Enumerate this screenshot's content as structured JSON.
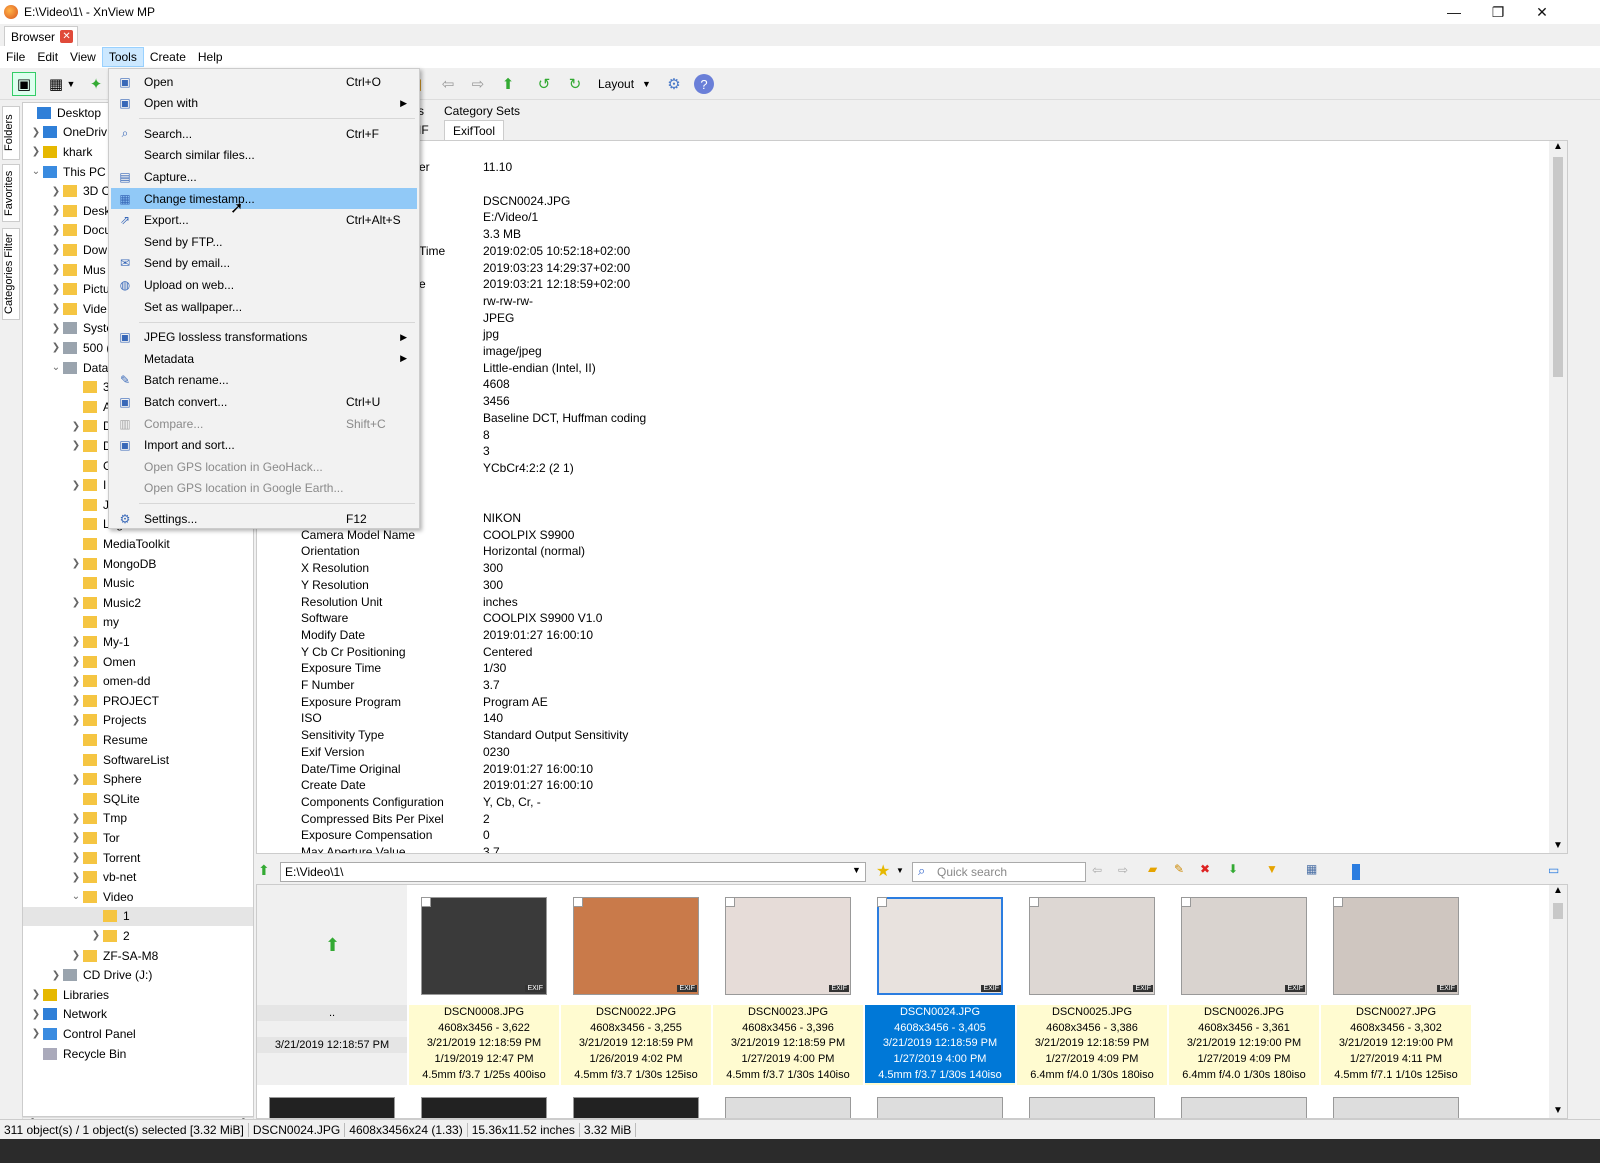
{
  "window": {
    "title": "E:\\Video\\1\\ - XnView MP",
    "min": "—",
    "max": "❐",
    "close": "✕"
  },
  "tab": {
    "label": "Browser",
    "close": "✕"
  },
  "menubar": [
    "File",
    "Edit",
    "View",
    "Tools",
    "Create",
    "Help"
  ],
  "toolbar": {
    "layout_label": "Layout"
  },
  "sidetabs": [
    "Folders",
    "Favorites",
    "Categories Filter"
  ],
  "tree": [
    {
      "label": "Desktop",
      "indent": 0,
      "arrow": "",
      "icon": "desktop"
    },
    {
      "label": "OneDriv",
      "indent": 1,
      "arrow": ">",
      "icon": "cloud"
    },
    {
      "label": "khark",
      "indent": 1,
      "arrow": ">",
      "icon": "user"
    },
    {
      "label": "This PC",
      "indent": 1,
      "arrow": "v",
      "icon": "pc"
    },
    {
      "label": "3D O",
      "indent": 2,
      "arrow": ">",
      "icon": "folder"
    },
    {
      "label": "Desk",
      "indent": 2,
      "arrow": ">",
      "icon": "folder"
    },
    {
      "label": "Docu",
      "indent": 2,
      "arrow": ">",
      "icon": "folder"
    },
    {
      "label": "Dow",
      "indent": 2,
      "arrow": ">",
      "icon": "folder"
    },
    {
      "label": "Mus",
      "indent": 2,
      "arrow": ">",
      "icon": "folder"
    },
    {
      "label": "Pictu",
      "indent": 2,
      "arrow": ">",
      "icon": "folder"
    },
    {
      "label": "Vide",
      "indent": 2,
      "arrow": ">",
      "icon": "folder"
    },
    {
      "label": "Syste",
      "indent": 2,
      "arrow": ">",
      "icon": "drive"
    },
    {
      "label": "500 (",
      "indent": 2,
      "arrow": ">",
      "icon": "drive"
    },
    {
      "label": "Data",
      "indent": 2,
      "arrow": "v",
      "icon": "drive"
    },
    {
      "label": "3",
      "indent": 3,
      "arrow": "",
      "icon": "folder"
    },
    {
      "label": "A",
      "indent": 3,
      "arrow": "",
      "icon": "folder"
    },
    {
      "label": "D",
      "indent": 3,
      "arrow": ">",
      "icon": "folder"
    },
    {
      "label": "D",
      "indent": 3,
      "arrow": ">",
      "icon": "folder"
    },
    {
      "label": "G",
      "indent": 3,
      "arrow": "",
      "icon": "folder"
    },
    {
      "label": "I",
      "indent": 3,
      "arrow": ">",
      "icon": "folder"
    },
    {
      "label": "J",
      "indent": 3,
      "arrow": "",
      "icon": "folder"
    },
    {
      "label": "LoginScreen",
      "indent": 3,
      "arrow": "",
      "icon": "folder"
    },
    {
      "label": "MediaToolkit",
      "indent": 3,
      "arrow": "",
      "icon": "folder"
    },
    {
      "label": "MongoDB",
      "indent": 3,
      "arrow": ">",
      "icon": "folder"
    },
    {
      "label": "Music",
      "indent": 3,
      "arrow": "",
      "icon": "folder"
    },
    {
      "label": "Music2",
      "indent": 3,
      "arrow": ">",
      "icon": "folder"
    },
    {
      "label": "my",
      "indent": 3,
      "arrow": "",
      "icon": "folder"
    },
    {
      "label": "My-1",
      "indent": 3,
      "arrow": ">",
      "icon": "folder"
    },
    {
      "label": "Omen",
      "indent": 3,
      "arrow": ">",
      "icon": "folder"
    },
    {
      "label": "omen-dd",
      "indent": 3,
      "arrow": ">",
      "icon": "folder"
    },
    {
      "label": "PROJECT",
      "indent": 3,
      "arrow": ">",
      "icon": "folder"
    },
    {
      "label": "Projects",
      "indent": 3,
      "arrow": ">",
      "icon": "folder"
    },
    {
      "label": "Resume",
      "indent": 3,
      "arrow": "",
      "icon": "folder"
    },
    {
      "label": "SoftwareList",
      "indent": 3,
      "arrow": "",
      "icon": "folder"
    },
    {
      "label": "Sphere",
      "indent": 3,
      "arrow": ">",
      "icon": "folder"
    },
    {
      "label": "SQLite",
      "indent": 3,
      "arrow": "",
      "icon": "folder"
    },
    {
      "label": "Tmp",
      "indent": 3,
      "arrow": ">",
      "icon": "folder"
    },
    {
      "label": "Tor",
      "indent": 3,
      "arrow": ">",
      "icon": "folder"
    },
    {
      "label": "Torrent",
      "indent": 3,
      "arrow": ">",
      "icon": "folder"
    },
    {
      "label": "vb-net",
      "indent": 3,
      "arrow": ">",
      "icon": "folder"
    },
    {
      "label": "Video",
      "indent": 3,
      "arrow": "v",
      "icon": "folder"
    },
    {
      "label": "1",
      "indent": 4,
      "arrow": "",
      "icon": "folder",
      "selected": true
    },
    {
      "label": "2",
      "indent": 4,
      "arrow": ">",
      "icon": "folder"
    },
    {
      "label": "ZF-SA-M8",
      "indent": 3,
      "arrow": ">",
      "icon": "folder"
    },
    {
      "label": "CD Drive (J:)",
      "indent": 2,
      "arrow": ">",
      "icon": "cd"
    },
    {
      "label": "Libraries",
      "indent": 1,
      "arrow": ">",
      "icon": "lib"
    },
    {
      "label": "Network",
      "indent": 1,
      "arrow": ">",
      "icon": "net"
    },
    {
      "label": "Control Panel",
      "indent": 1,
      "arrow": ">",
      "icon": "cp"
    },
    {
      "label": "Recycle Bin",
      "indent": 1,
      "arrow": "",
      "icon": "bin"
    }
  ],
  "infotabs": {
    "top_partial": "s",
    "category_sets": "Category Sets",
    "exif_partial": "IF",
    "exiftool": "ExifTool"
  },
  "info_rows": [
    {
      "k": "er",
      "v": "11.10",
      "partial": true
    },
    {
      "k": "",
      "v": ""
    },
    {
      "k": "",
      "v": "DSCN0024.JPG"
    },
    {
      "k": "",
      "v": "E:/Video/1"
    },
    {
      "k": "",
      "v": "3.3 MB"
    },
    {
      "k": "Time",
      "v": "2019:02:05 10:52:18+02:00",
      "partial": true
    },
    {
      "k": "",
      "v": "2019:03:23 14:29:37+02:00"
    },
    {
      "k": "e",
      "v": "2019:03:21 12:18:59+02:00",
      "partial": true
    },
    {
      "k": "",
      "v": "rw-rw-rw-"
    },
    {
      "k": "",
      "v": "JPEG"
    },
    {
      "k": "",
      "v": "jpg"
    },
    {
      "k": "",
      "v": "image/jpeg"
    },
    {
      "k": "",
      "v": "Little-endian (Intel, II)"
    },
    {
      "k": "",
      "v": "4608"
    },
    {
      "k": "",
      "v": "3456"
    },
    {
      "k": "",
      "v": "Baseline DCT, Huffman coding"
    },
    {
      "k": "",
      "v": "8"
    },
    {
      "k": "",
      "v": "3"
    },
    {
      "k": "",
      "v": "YCbCr4:2:2 (2 1)"
    },
    {
      "k": "",
      "v": ""
    },
    {
      "k": "",
      "v": ""
    },
    {
      "k": "",
      "v": "NIKON"
    },
    {
      "k": "Camera Model Name",
      "v": "COOLPIX S9900"
    },
    {
      "k": "Orientation",
      "v": "Horizontal (normal)"
    },
    {
      "k": "X Resolution",
      "v": "300"
    },
    {
      "k": "Y Resolution",
      "v": "300"
    },
    {
      "k": "Resolution Unit",
      "v": "inches"
    },
    {
      "k": "Software",
      "v": "COOLPIX S9900 V1.0"
    },
    {
      "k": "Modify Date",
      "v": "2019:01:27 16:00:10"
    },
    {
      "k": "Y Cb Cr Positioning",
      "v": "Centered"
    },
    {
      "k": "Exposure Time",
      "v": "1/30"
    },
    {
      "k": "F Number",
      "v": "3.7"
    },
    {
      "k": "Exposure Program",
      "v": "Program AE"
    },
    {
      "k": "ISO",
      "v": "140"
    },
    {
      "k": "Sensitivity Type",
      "v": "Standard Output Sensitivity"
    },
    {
      "k": "Exif Version",
      "v": "0230"
    },
    {
      "k": "Date/Time Original",
      "v": "2019:01:27 16:00:10"
    },
    {
      "k": "Create Date",
      "v": "2019:01:27 16:00:10"
    },
    {
      "k": "Components Configuration",
      "v": "Y, Cb, Cr, -"
    },
    {
      "k": "Compressed Bits Per Pixel",
      "v": "2"
    },
    {
      "k": "Exposure Compensation",
      "v": "0"
    },
    {
      "k": "Max Aperture Value",
      "v": "3.7"
    }
  ],
  "pathbar": {
    "path": "E:\\Video\\1\\",
    "quick_search_placeholder": "Quick search"
  },
  "parent_cell": {
    "name": "..",
    "date": "3/21/2019 12:18:57 PM"
  },
  "thumbs": [
    {
      "name": "DSCN0008.JPG",
      "dims": "4608x3456 - 3,622",
      "modified": "3/21/2019 12:18:59 PM",
      "taken": "1/19/2019 12:47 PM",
      "exif": "4.5mm f/3.7 1/25s 400iso",
      "color": "#3a3a3a",
      "selected": false
    },
    {
      "name": "DSCN0022.JPG",
      "dims": "4608x3456 - 3,255",
      "modified": "3/21/2019 12:18:59 PM",
      "taken": "1/26/2019 4:02 PM",
      "exif": "4.5mm f/3.7 1/30s 125iso",
      "color": "#c97a4a",
      "selected": false
    },
    {
      "name": "DSCN0023.JPG",
      "dims": "4608x3456 - 3,396",
      "modified": "3/21/2019 12:18:59 PM",
      "taken": "1/27/2019 4:00 PM",
      "exif": "4.5mm f/3.7 1/30s 140iso",
      "color": "#e6dcd8",
      "selected": false
    },
    {
      "name": "DSCN0024.JPG",
      "dims": "4608x3456 - 3,405",
      "modified": "3/21/2019 12:18:59 PM",
      "taken": "1/27/2019 4:00 PM",
      "exif": "4.5mm f/3.7 1/30s 140iso",
      "color": "#e8e2de",
      "selected": true
    },
    {
      "name": "DSCN0025.JPG",
      "dims": "4608x3456 - 3,386",
      "modified": "3/21/2019 12:18:59 PM",
      "taken": "1/27/2019 4:09 PM",
      "exif": "6.4mm f/4.0 1/30s 180iso",
      "color": "#ddd7d3",
      "selected": false
    },
    {
      "name": "DSCN0026.JPG",
      "dims": "4608x3456 - 3,361",
      "modified": "3/21/2019 12:19:00 PM",
      "taken": "1/27/2019 4:09 PM",
      "exif": "6.4mm f/4.0 1/30s 180iso",
      "color": "#d9d3cf",
      "selected": false
    },
    {
      "name": "DSCN0027.JPG",
      "dims": "4608x3456 - 3,302",
      "modified": "3/21/2019 12:19:00 PM",
      "taken": "1/27/2019 4:11 PM",
      "exif": "4.5mm f/7.1 1/10s 125iso",
      "color": "#cfc6c0",
      "selected": false
    }
  ],
  "statusbar": [
    "311 object(s) / 1 object(s) selected [3.32 MiB]",
    "DSCN0024.JPG",
    "4608x3456x24 (1.33)",
    "15.36x11.52 inches",
    "3.32 MiB"
  ],
  "tools_menu": [
    {
      "label": "Open",
      "shortcut": "Ctrl+O",
      "icon": "open-icon",
      "glyph": "▣",
      "sub": false,
      "state": "normal"
    },
    {
      "label": "Open with",
      "shortcut": "",
      "icon": "open-with-icon",
      "glyph": "▣",
      "sub": true,
      "state": "normal"
    },
    {
      "sep": true
    },
    {
      "label": "Search...",
      "shortcut": "Ctrl+F",
      "icon": "binoculars-icon",
      "glyph": "⌕",
      "sub": false,
      "state": "normal"
    },
    {
      "label": "Search similar files...",
      "shortcut": "",
      "icon": "",
      "glyph": "",
      "sub": false,
      "state": "normal"
    },
    {
      "label": "Capture...",
      "shortcut": "",
      "icon": "capture-icon",
      "glyph": "▤",
      "sub": false,
      "state": "normal"
    },
    {
      "label": "Change timestamp...",
      "shortcut": "",
      "icon": "timestamp-icon",
      "glyph": "▦",
      "sub": false,
      "state": "highlight"
    },
    {
      "label": "Export...",
      "shortcut": "Ctrl+Alt+S",
      "icon": "export-icon",
      "glyph": "⇗",
      "sub": false,
      "state": "normal"
    },
    {
      "label": "Send by FTP...",
      "shortcut": "",
      "icon": "",
      "glyph": "",
      "sub": false,
      "state": "normal"
    },
    {
      "label": "Send by email...",
      "shortcut": "",
      "icon": "email-icon",
      "glyph": "✉",
      "sub": false,
      "state": "normal"
    },
    {
      "label": "Upload on web...",
      "shortcut": "",
      "icon": "globe-icon",
      "glyph": "◍",
      "sub": false,
      "state": "normal"
    },
    {
      "label": "Set as wallpaper...",
      "shortcut": "",
      "icon": "",
      "glyph": "",
      "sub": false,
      "state": "normal"
    },
    {
      "sep": true
    },
    {
      "label": "JPEG lossless transformations",
      "shortcut": "",
      "icon": "jpeg-transform-icon",
      "glyph": "▣",
      "sub": true,
      "state": "normal"
    },
    {
      "label": "Metadata",
      "shortcut": "",
      "icon": "",
      "glyph": "",
      "sub": true,
      "state": "normal"
    },
    {
      "label": "Batch rename...",
      "shortcut": "",
      "icon": "batch-rename-icon",
      "glyph": "✎",
      "sub": false,
      "state": "normal"
    },
    {
      "label": "Batch convert...",
      "shortcut": "Ctrl+U",
      "icon": "batch-convert-icon",
      "glyph": "▣",
      "sub": false,
      "state": "normal"
    },
    {
      "label": "Compare...",
      "shortcut": "Shift+C",
      "icon": "compare-icon",
      "glyph": "▥",
      "sub": false,
      "state": "disabled"
    },
    {
      "label": "Import and sort...",
      "shortcut": "",
      "icon": "import-icon",
      "glyph": "▣",
      "sub": false,
      "state": "normal"
    },
    {
      "label": "Open GPS location in GeoHack...",
      "shortcut": "",
      "icon": "",
      "glyph": "",
      "sub": false,
      "state": "disabled"
    },
    {
      "label": "Open GPS location in Google Earth...",
      "shortcut": "",
      "icon": "",
      "glyph": "",
      "sub": false,
      "state": "disabled"
    },
    {
      "sep": true
    },
    {
      "label": "Settings...",
      "shortcut": "F12",
      "icon": "settings-icon",
      "glyph": "⚙",
      "sub": false,
      "state": "normal"
    }
  ]
}
